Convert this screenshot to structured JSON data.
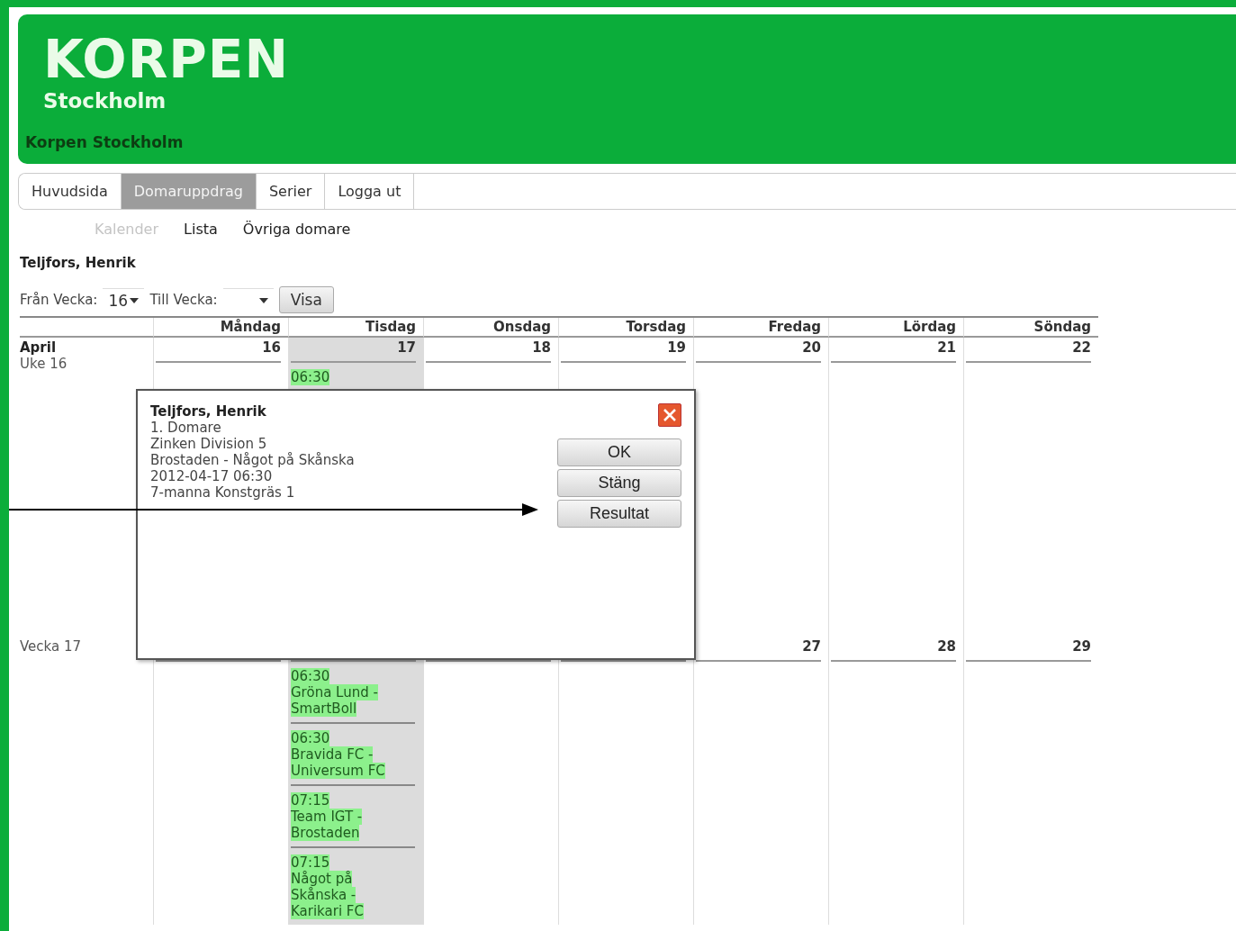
{
  "header": {
    "logo": "KORPEN",
    "logo_subtitle": "Stockholm",
    "site_name": "Korpen Stockholm"
  },
  "tabs": [
    {
      "label": "Huvudsida",
      "selected": false
    },
    {
      "label": "Domaruppdrag",
      "selected": true
    },
    {
      "label": "Serier",
      "selected": false
    },
    {
      "label": "Logga ut",
      "selected": false
    }
  ],
  "subtabs": [
    {
      "label": "Kalender",
      "selected": true
    },
    {
      "label": "Lista",
      "selected": false
    },
    {
      "label": "Övriga domare",
      "selected": false
    }
  ],
  "referee_name": "Teljfors, Henrik",
  "filter": {
    "from_label": "Från Vecka:",
    "from_value": "16",
    "to_label": "Till Vecka:",
    "button": "Visa"
  },
  "days": [
    {
      "name": "Måndag",
      "selected": false
    },
    {
      "name": "Tisdag",
      "selected": true
    },
    {
      "name": "Onsdag",
      "selected": false
    },
    {
      "name": "Torsdag",
      "selected": false
    },
    {
      "name": "Fredag",
      "selected": false
    },
    {
      "name": "Lördag",
      "selected": false
    },
    {
      "name": "Söndag",
      "selected": false
    }
  ],
  "weeks": [
    {
      "month": "April",
      "week": "Uke 16",
      "cells": [
        {
          "date": "16"
        },
        {
          "date": "17",
          "events": [
            {
              "time": "06:30"
            }
          ]
        },
        {
          "date": "18"
        },
        {
          "date": "19"
        },
        {
          "date": "20"
        },
        {
          "date": "21"
        },
        {
          "date": "22"
        }
      ]
    },
    {
      "week": "Vecka 17",
      "cells": [
        {},
        {
          "events": [
            {
              "time": "06:30",
              "title": "Gröna Lund - SmartBoll"
            },
            {
              "time": "06:30",
              "title": "Bravida FC - Universum FC"
            },
            {
              "time": "07:15",
              "title": "Team IGT - Brostaden"
            },
            {
              "time": "07:15",
              "title": "Något på Skånska - Karikari FC"
            }
          ]
        },
        {},
        {},
        {
          "date": "27"
        },
        {
          "date": "28"
        },
        {
          "date": "29"
        }
      ]
    }
  ],
  "dialog": {
    "title": "Teljfors, Henrik",
    "lines": [
      "1. Domare",
      "Zinken Division 5",
      "Brostaden - Något på Skånska",
      "2012-04-17 06:30",
      "7-manna Konstgräs 1"
    ],
    "buttons": [
      "OK",
      "Stäng",
      "Resultat"
    ]
  }
}
